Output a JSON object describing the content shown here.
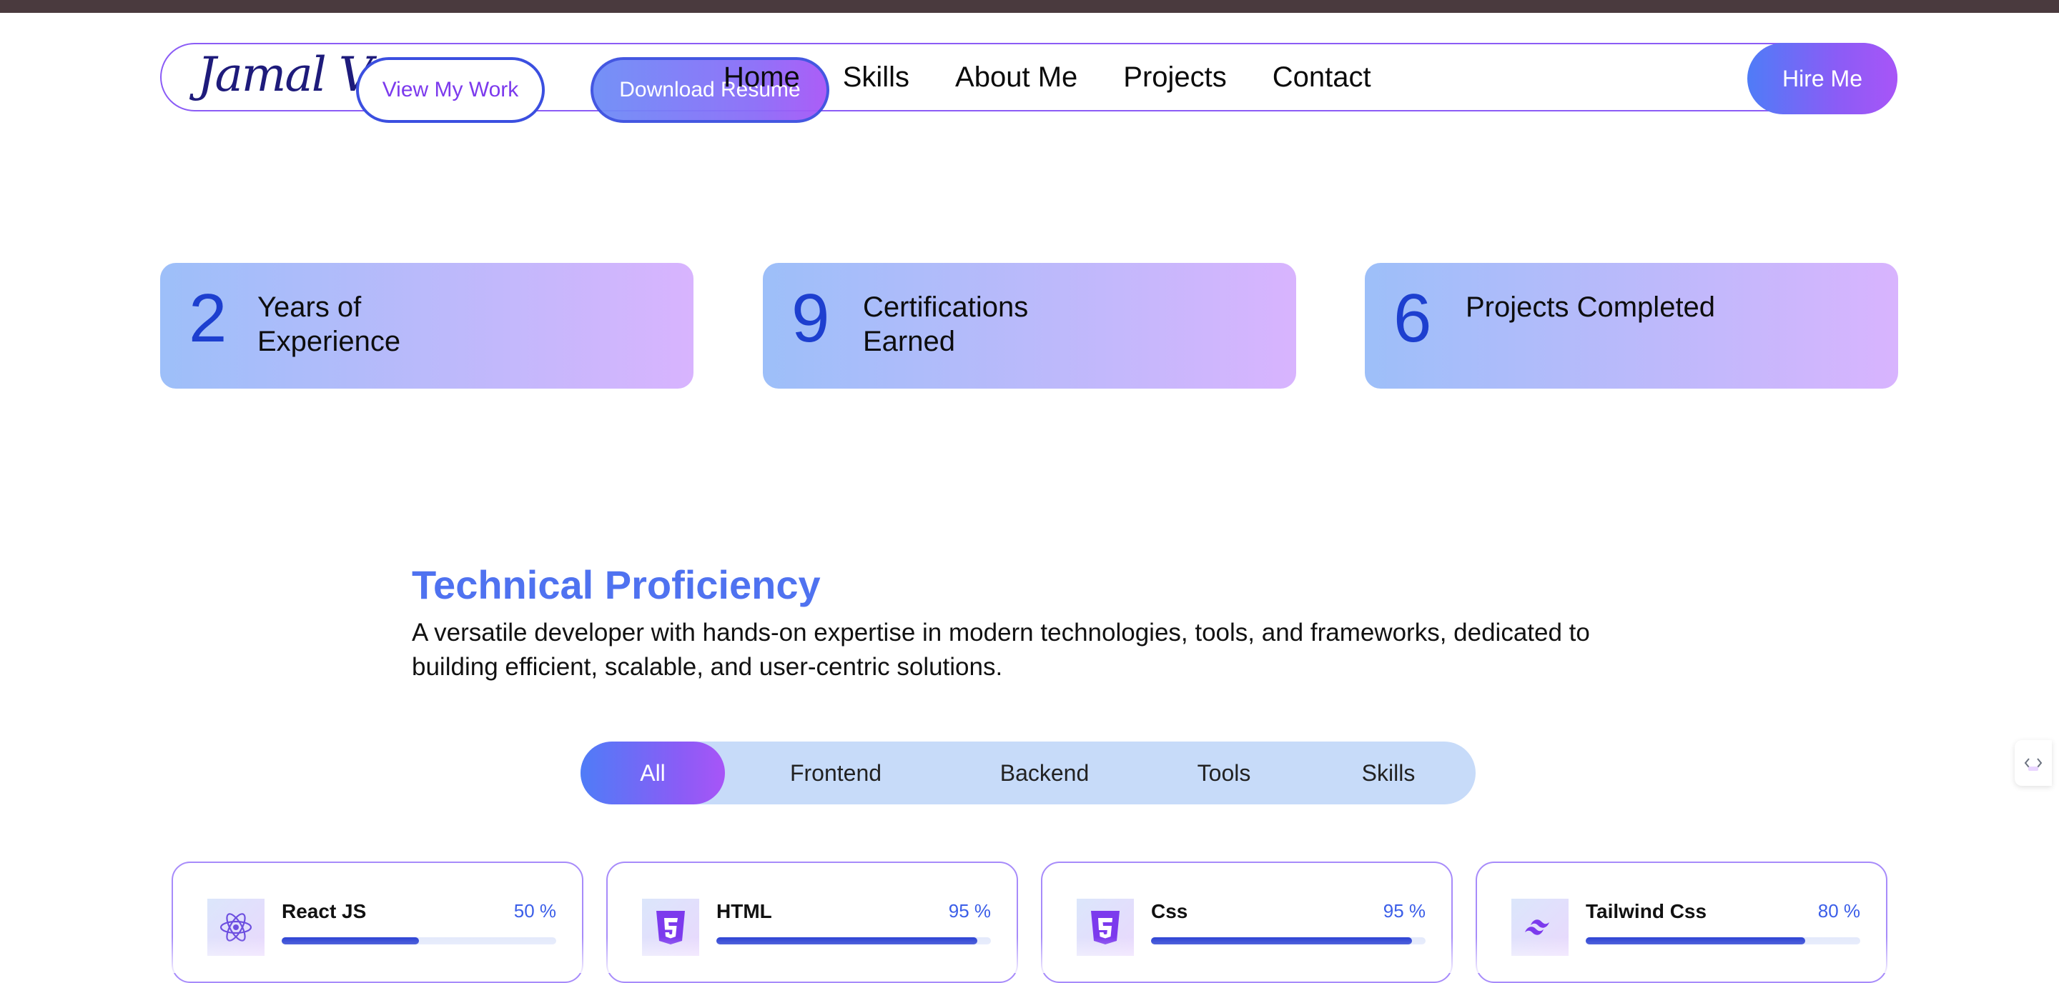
{
  "nav": {
    "logo": "Jamal Veve",
    "links": [
      "Home",
      "Skills",
      "About Me",
      "Projects",
      "Contact"
    ],
    "view_work": "View My Work",
    "download_resume": "Download Resume",
    "hire_me": "Hire Me"
  },
  "stats": [
    {
      "value": "2",
      "label": "Years of Experience"
    },
    {
      "value": "9",
      "label": "Certifications Earned"
    },
    {
      "value": "6",
      "label": "Projects Completed"
    }
  ],
  "tech": {
    "title": "Technical Proficiency",
    "description": "A versatile developer with hands-on expertise in modern technologies, tools, and frameworks, dedicated to building efficient, scalable, and user-centric solutions."
  },
  "tabs": [
    "All",
    "Frontend",
    "Backend",
    "Tools",
    "Skills"
  ],
  "active_tab": "All",
  "skills": [
    {
      "name": "React JS",
      "percent_label": "50 %",
      "level": 0.5,
      "icon": "react-icon"
    },
    {
      "name": "HTML",
      "percent_label": "95 %",
      "level": 0.95,
      "icon": "html5-icon"
    },
    {
      "name": "Css",
      "percent_label": "95 %",
      "level": 0.95,
      "icon": "css3-icon"
    },
    {
      "name": "Tailwind Css",
      "percent_label": "80 %",
      "level": 0.8,
      "icon": "tailwind-icon"
    }
  ],
  "colors": {
    "accent_blue": "#4f72f0",
    "accent_purple": "#a855f7",
    "bar_fill": "#2d43d4",
    "number_blue": "#1d3fcf"
  }
}
